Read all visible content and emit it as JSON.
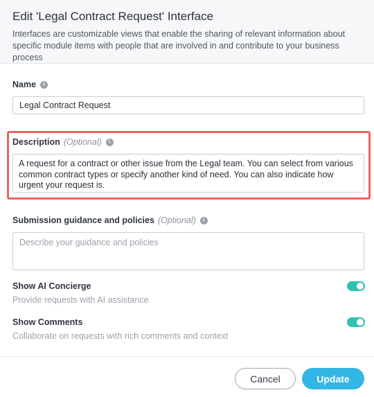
{
  "header": {
    "title": "Edit 'Legal Contract Request' Interface",
    "subtitle": "Interfaces are customizable views that enable the sharing of relevant information about specific module items with people that are involved in and contribute to your business process"
  },
  "name_field": {
    "label": "Name",
    "value": "Legal Contract Request"
  },
  "description_field": {
    "label": "Description",
    "optional": "(Optional)",
    "value": "A request for a contract or other issue from the Legal team. You can select from various common contract types or specify another kind of need. You can also indicate how urgent your request is."
  },
  "guidance_field": {
    "label": "Submission guidance and policies",
    "optional": "(Optional)",
    "placeholder": "Describe your guidance and policies"
  },
  "ai_concierge": {
    "label": "Show AI Concierge",
    "help": "Provide requests with AI assistance",
    "enabled": true
  },
  "comments": {
    "label": "Show Comments",
    "help": "Collaborate on requests with rich comments and context",
    "enabled": true
  },
  "footer": {
    "cancel_label": "Cancel",
    "update_label": "Update"
  },
  "colors": {
    "accent": "#33b5e5",
    "toggle_on": "#2ec4b0",
    "highlight": "#e8655a"
  }
}
